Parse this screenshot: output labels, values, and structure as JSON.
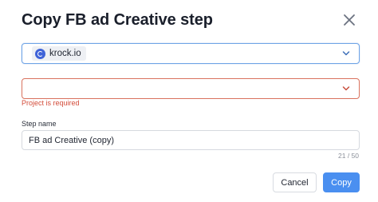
{
  "dialog": {
    "title": "Copy FB ad Creative step",
    "close_icon": "close-icon"
  },
  "workspace_select": {
    "selected_label": "krock.io",
    "logo_icon": "krock-logo-icon",
    "chevron_icon": "chevron-down-icon",
    "border_color": "#6fa4e6"
  },
  "project_select": {
    "selected_label": "",
    "chevron_icon": "chevron-down-icon",
    "border_color": "#d9725e",
    "error": "Project is required"
  },
  "step_name": {
    "label": "Step name",
    "value": "FB ad Creative (copy)",
    "counter": "21 / 50"
  },
  "actions": {
    "cancel_label": "Cancel",
    "copy_label": "Copy",
    "primary_color": "#4a8ff0"
  }
}
